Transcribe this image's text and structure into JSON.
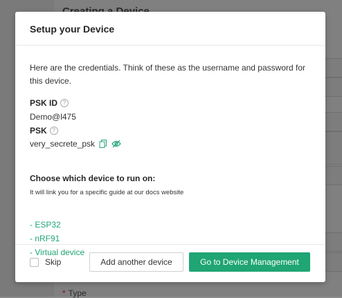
{
  "background": {
    "page_title": "Creating a Device",
    "type_label": "Type",
    "required_marker": "*"
  },
  "modal": {
    "title": "Setup your Device",
    "intro": "Here are the credentials. Think of these as the username and password for this device.",
    "psk_id": {
      "label": "PSK ID",
      "value": "Demo@l475",
      "icon": "question-circle-icon"
    },
    "psk": {
      "label": "PSK",
      "value": "very_secrete_psk",
      "icon": "question-circle-icon",
      "copy_icon": "copy-icon",
      "reveal_icon": "eye-slash-icon"
    },
    "choose_title": "Choose which device to run on:",
    "choose_hint": "It will link you for a specific guide at our docs website",
    "devices": [
      "- ESP32",
      "- nRF91",
      "- Virtual device"
    ],
    "footer": {
      "skip_label": "Skip",
      "skip_checked": false,
      "add_another_label": "Add another device",
      "go_management_label": "Go to Device Management"
    }
  },
  "colors": {
    "accent": "#20a574",
    "overlay": "#808080"
  }
}
